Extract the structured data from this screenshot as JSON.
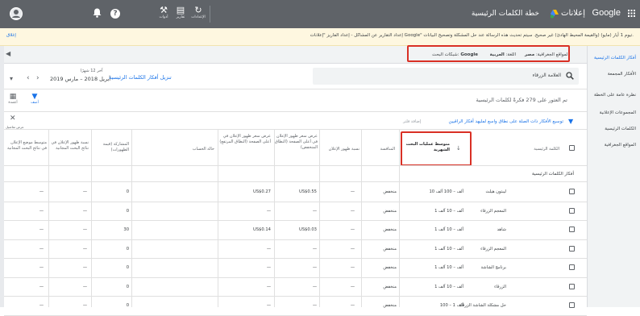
{
  "topbar": {
    "logo_text": "Google",
    "product": "إعلانات",
    "page_title": "خطة الكلمات الرئيسية",
    "icons": [
      {
        "name": "tools-icon",
        "label": "أدوات"
      },
      {
        "name": "reports-icon",
        "label": "تقارير"
      },
      {
        "name": "refresh-icon",
        "label": "الإعدادات"
      }
    ]
  },
  "notice": {
    "text": "إعداد التقارير عن المشاكل - إعداد الفاريز \"إعلانات Google\" تيوم 1 أيار (مايو) (والقيمة المحيط الهادئ) غير صحيح. سيتم تحديث هذه الرسالة عند حل المشكلة وتصحيح البيانات.",
    "dismiss": "إغلاق"
  },
  "filters": {
    "location_label": "المواقع الجغرافية:",
    "location_value": "مصر",
    "language_label": "اللغة:",
    "language_value": "العربية",
    "network_label": "شبكات البحث:",
    "network_value": "Google"
  },
  "sidebar": {
    "items": [
      {
        "label": "أفكار الكلمات الرئيسية",
        "active": true
      },
      {
        "label": "الأفكار المجمعة",
        "active": false
      },
      {
        "label": "نظرة عامة على الخطة",
        "active": false
      },
      {
        "label": "المجموعات الإعلانية",
        "active": false
      },
      {
        "label": "الكلمات الرئيسية",
        "active": false
      },
      {
        "label": "المواقع الجغرافية",
        "active": false
      }
    ]
  },
  "search": {
    "placeholder": "العلامة الزرقاء"
  },
  "date": {
    "range_label": "آخر 12 شهرًا",
    "range_value": "أبريل 2018 – مارس 2019",
    "download": "تنزيل أفكار الكلمات الرئيسية"
  },
  "results": {
    "count_text": "تم العثور على 279 فكرةً لكلمات الرئيسية"
  },
  "toolbar": {
    "filter_label": "أضف",
    "columns_label": "أعمدة",
    "hint": "توسيع الأفكار ذات الصلة على نطاق واسع لمليهد أفكار الراقيين",
    "hint_link": "إضافة فلتر",
    "expand": "عرض تفاصيل"
  },
  "table": {
    "headers": {
      "keyword": "الكلمة الرئيسية",
      "avg_searches": "متوسط عمليات البحث الشهرية",
      "competition": "المنافسة",
      "impr_share": "نسبة ظهور الإعلان",
      "bid_low": "عرض سعر ظهور الإعلان في أعلى الصفحة (النطاق المنخفض)",
      "bid_high": "عرض سعر ظهور الإعلان في أعلى الصفحة (النطاق المرتفع)",
      "account_status": "حالة الحساب",
      "organic_impr": "المشاركة (قيمة الظهورات)",
      "organic_avg_pos": "نسبة ظهور الإعلان في نتائج البحث المجانية",
      "organic_pos": "متوسط موضع الإعلان في نتائج البحث المجانية"
    },
    "group_label": "أفكار الكلمات الرئيسية",
    "rows": [
      {
        "keyword": "ليبتون هيلث",
        "searches": "10 آلف – 100 آلف",
        "competition": "منخفض",
        "impr": "—",
        "bid_low": "US$0.55",
        "bid_high": "US$0.27",
        "status": "",
        "organic": "0",
        "org_share": "—",
        "org_pos": "—"
      },
      {
        "keyword": "المعجم الزرقاء",
        "searches": "1 آلف – 10 آلف",
        "competition": "منخفض",
        "impr": "—",
        "bid_low": "—",
        "bid_high": "—",
        "status": "",
        "organic": "0",
        "org_share": "—",
        "org_pos": "—"
      },
      {
        "keyword": "شاهد",
        "searches": "1 آلف – 10 آلف",
        "competition": "منخفض",
        "impr": "—",
        "bid_low": "US$0.03",
        "bid_high": "US$0.14",
        "status": "",
        "organic": "30",
        "org_share": "—",
        "org_pos": "—"
      },
      {
        "keyword": "المعجم الزرقاء",
        "searches": "1 آلف – 10 آلف",
        "competition": "منخفض",
        "impr": "—",
        "bid_low": "—",
        "bid_high": "—",
        "status": "",
        "organic": "0",
        "org_share": "—",
        "org_pos": "—"
      },
      {
        "keyword": "برنامج الشاشة",
        "searches": "1 آلف – 10 آلف",
        "competition": "منخفض",
        "impr": "—",
        "bid_low": "—",
        "bid_high": "—",
        "status": "",
        "organic": "0",
        "org_share": "—",
        "org_pos": "—"
      },
      {
        "keyword": "الزرقاء",
        "searches": "1 آلف – 10 آلف",
        "competition": "منخفض",
        "impr": "—",
        "bid_low": "—",
        "bid_high": "—",
        "status": "",
        "organic": "0",
        "org_share": "—",
        "org_pos": "—"
      },
      {
        "keyword": "حل مشكلة الشاشة الزرقاء",
        "searches": "100 – 1 آلف",
        "competition": "منخفض",
        "impr": "—",
        "bid_low": "—",
        "bid_high": "—",
        "status": "",
        "organic": "0",
        "org_share": "—",
        "org_pos": "—"
      }
    ]
  }
}
